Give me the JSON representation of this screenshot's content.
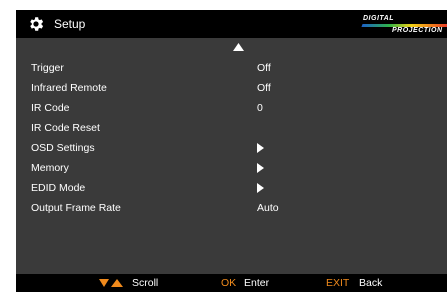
{
  "header": {
    "title": "Setup",
    "icon": "gear-icon",
    "logo_top": "DIGITAL",
    "logo_bottom": "PROJECTION"
  },
  "menu": {
    "scroll_up_icon": "triangle-up-icon",
    "items": [
      {
        "label": "Trigger",
        "value": "Off"
      },
      {
        "label": "Infrared Remote",
        "value": "Off"
      },
      {
        "label": "IR Code",
        "value": "0"
      },
      {
        "label": "IR Code Reset",
        "value": ""
      },
      {
        "label": "OSD Settings",
        "value": "",
        "submenu_icon": "triangle-right-icon"
      },
      {
        "label": "Memory",
        "value": "",
        "submenu_icon": "triangle-right-icon"
      },
      {
        "label": "EDID Mode",
        "value": "",
        "submenu_icon": "triangle-right-icon"
      },
      {
        "label": "Output Frame Rate",
        "value": "Auto"
      }
    ]
  },
  "footer": {
    "scroll_label": "Scroll",
    "ok_key": "OK",
    "ok_label": "Enter",
    "exit_key": "EXIT",
    "exit_label": "Back"
  },
  "colors": {
    "panel_bg": "#3a3a3a",
    "bar_bg": "#000000",
    "text": "#ffffff",
    "accent": "#f08a1c"
  }
}
